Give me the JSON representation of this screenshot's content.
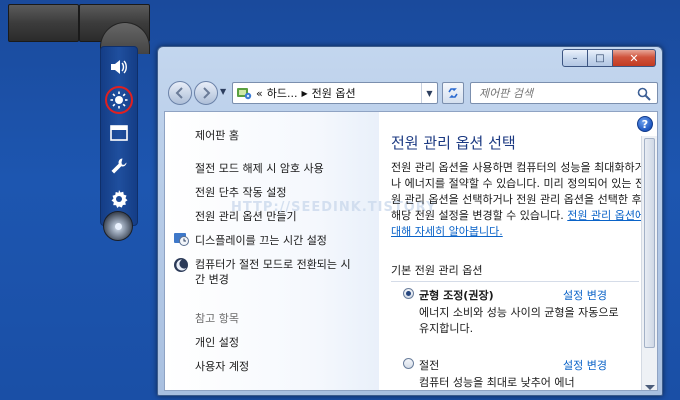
{
  "dock": {
    "icons": [
      "speaker-icon",
      "brightness-icon",
      "window-icon",
      "wrench-icon",
      "gear-icon",
      "disc-icon"
    ]
  },
  "window": {
    "caption_buttons": {
      "minimize": "–",
      "maximize": "□",
      "close": "✕"
    }
  },
  "address_bar": {
    "prefix": "«",
    "crumb_1": "하드...",
    "crumb_sep": "▶",
    "crumb_2": "전원 옵션"
  },
  "search": {
    "placeholder": "제어판 검색"
  },
  "left_pane": {
    "home": "제어판 홈",
    "items": [
      "절전 모드 해제 시 암호 사용",
      "전원 단추 작동 설정",
      "전원 관리 옵션 만들기",
      "디스플레이를 끄는 시간 설정",
      "컴퓨터가 절전 모드로 전환되는 시간 변경"
    ],
    "see_also_title": "참고 항목",
    "see_also": [
      "개인 설정",
      "사용자 계정"
    ]
  },
  "watermark": "HTTP://SEEDINK.TISTORY",
  "main": {
    "title": "전원 관리 옵션 선택",
    "description": "전원 관리 옵션을 사용하면 컴퓨터의 성능을 최대화하거나 에너지를 절약할 수 있습니다. 미리 정의되어 있는 전원 관리 옵션을 선택하거나 전원 관리 옵션을 선택한 후 해당 전원 설정을 변경할 수 있습니다.",
    "description_link": "전원 관리 옵션에 대해 자세히 알아봅니다.",
    "section_title": "기본 전원 관리 옵션",
    "plans": [
      {
        "name": "균형 조정(권장)",
        "change": "설정 변경",
        "desc": "에너지 소비와 성능 사이의 균형을 자동으로 유지합니다."
      },
      {
        "name": "절전",
        "change": "설정 변경",
        "desc": "컴퓨터 성능을 최대로 낮추어 에너"
      }
    ],
    "help": "?"
  }
}
